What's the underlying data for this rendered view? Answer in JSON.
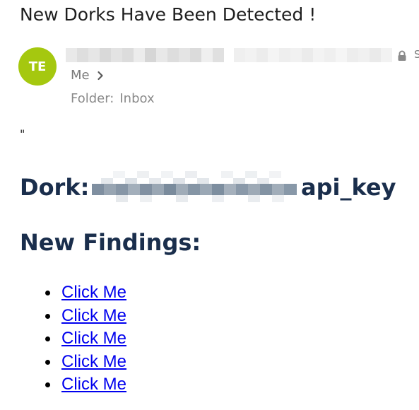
{
  "email": {
    "subject": "New Dorks Have Been Detected !",
    "sender": {
      "avatar_initials": "TE",
      "avatar_color": "#a5c80f",
      "name_redacted": true,
      "trailing_char": "S"
    },
    "recipient_label": "Me",
    "folder_label": "Folder:",
    "folder_value": "Inbox"
  },
  "body": {
    "quote": "\"",
    "dork_label": "Dork:",
    "dork_value_redacted": true,
    "dork_suffix": "api_key",
    "findings_heading": "New Findings:",
    "links": [
      {
        "label": "Click Me"
      },
      {
        "label": "Click Me"
      },
      {
        "label": "Click Me"
      },
      {
        "label": "Click Me"
      },
      {
        "label": "Click Me"
      }
    ]
  },
  "colors": {
    "heading": "#1a2e4c",
    "link": "#0000ee",
    "muted": "#7a7a7a"
  }
}
